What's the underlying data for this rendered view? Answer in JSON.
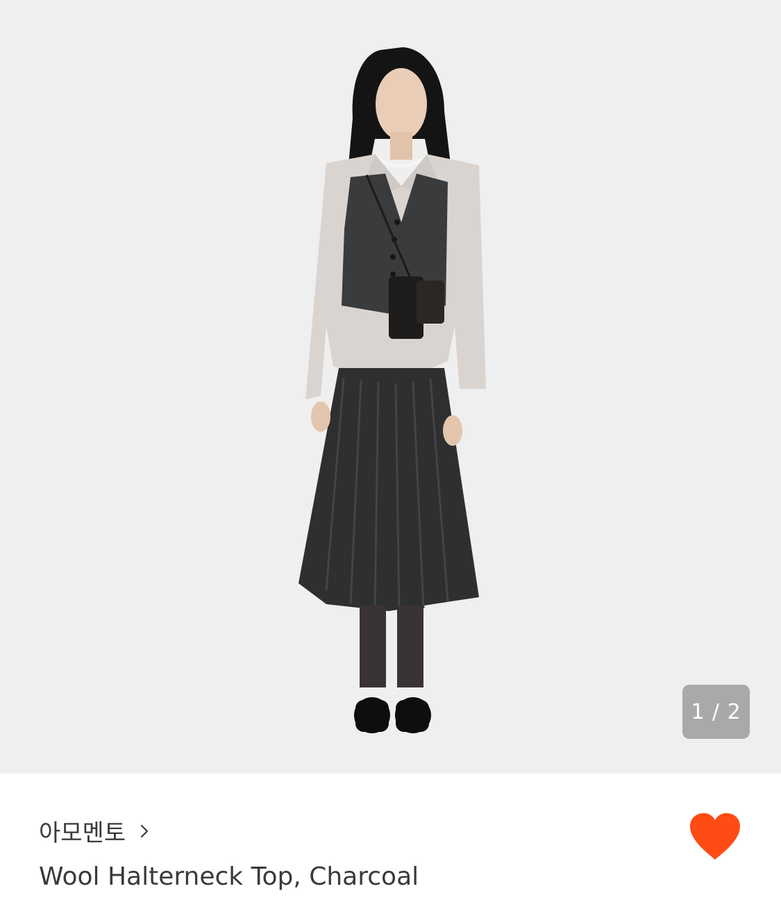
{
  "gallery": {
    "current_index": 1,
    "total": 2,
    "counter_text": "1 / 2",
    "image_icon": "fashion-model-photo"
  },
  "product": {
    "brand": "아모멘토",
    "name": "Wool Halterneck Top, Charcoal",
    "wishlisted": true
  },
  "colors": {
    "accent": "#ff4b14",
    "gallery_bg": "#efefef",
    "text": "#3a3a3a",
    "counter_bg": "#a9a9a9"
  },
  "icons": {
    "brand_chevron": "chevron-right-icon",
    "wishlist": "heart-icon"
  }
}
